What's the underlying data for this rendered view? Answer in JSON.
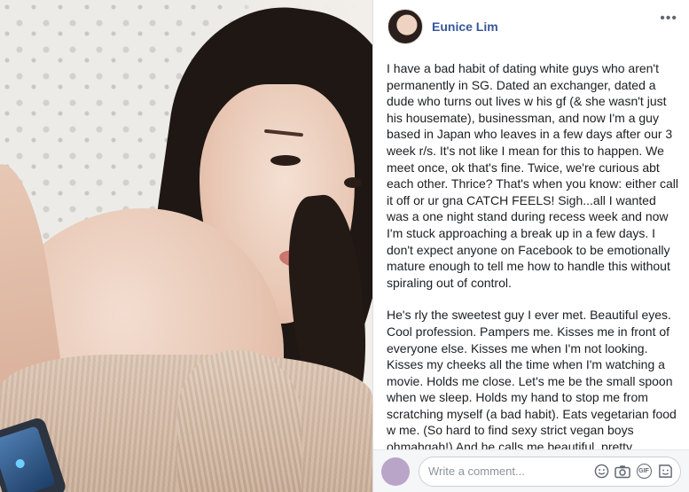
{
  "post": {
    "author_name": "Eunice Lim",
    "more_label": "•••",
    "paragraphs": [
      "I have a bad habit of dating white guys who aren't permanently in SG. Dated an exchanger, dated a dude who turns out lives w his gf (& she wasn't just his housemate), businessman, and now I'm a guy based in Japan who leaves in a few days after our 3 week r/s. It's not like I mean for this to happen. We meet once, ok that's fine. Twice, we're curious abt each other. Thrice? That's when you know: either call it off or ur gna CATCH FEELS! Sigh...all I wanted was a one night stand during recess week and now I'm stuck approaching a break up in a few days. I don't expect anyone on Facebook to be emotionally mature enough to tell me how to handle this without spiraling out of control.",
      "He's rly the sweetest guy I ever met. Beautiful eyes. Cool profession. Pampers me. Kisses me in front of everyone else. Kisses me when I'm not looking. Kisses my cheeks all the time when I'm watching a movie. Holds me close. Let's me be the small spoon when we sleep. Holds my hand to stop me from scratching myself (a bad habit). Eats vegetarian food w me. (So hard to find sexy strict vegan boys ohmahgah!) And he calls me beautiful, pretty,"
    ]
  },
  "comment": {
    "placeholder": "Write a comment...",
    "icons": [
      "emoji-icon",
      "camera-icon",
      "gif-icon",
      "sticker-icon"
    ],
    "gif_label": "GIF"
  },
  "colors": {
    "author_link": "#385898",
    "text": "#1c1e21",
    "comment_bar_bg": "#f5f6f7"
  }
}
